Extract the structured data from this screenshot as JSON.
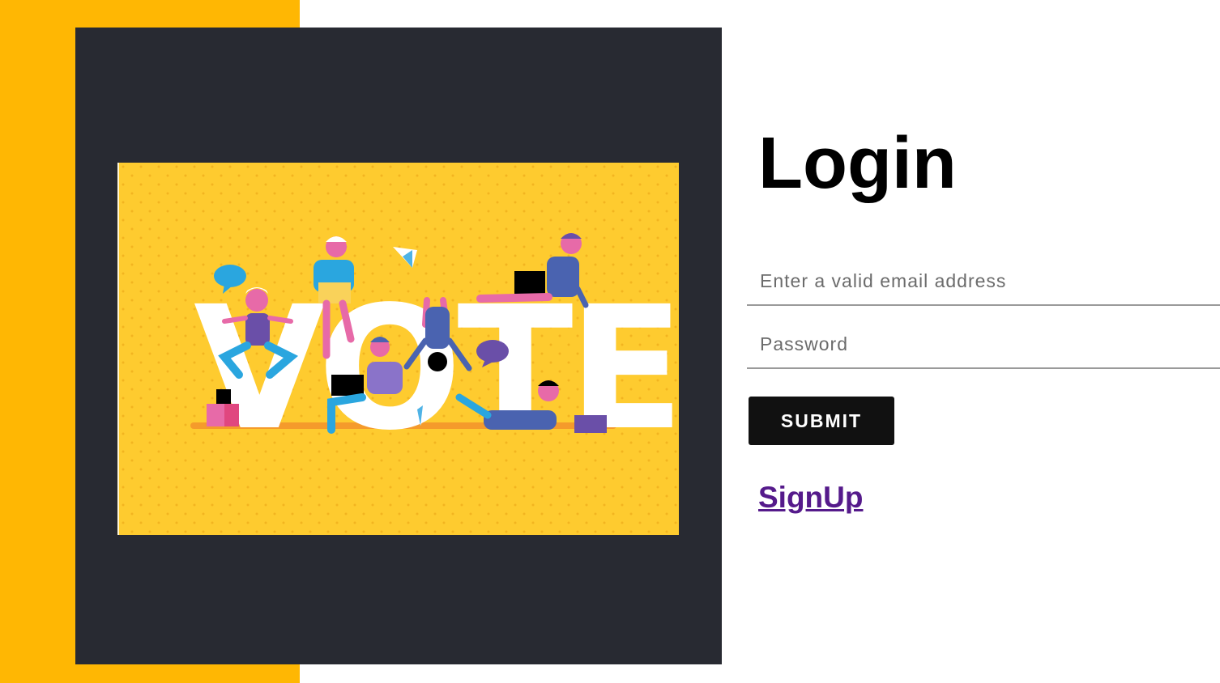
{
  "login": {
    "title": "Login",
    "email_placeholder": "Enter a valid email address",
    "password_placeholder": "Password",
    "submit_label": "SUBMIT",
    "signup_label": "SignUp"
  },
  "illustration": {
    "text": "VOTE",
    "background_color": "#fecb2f"
  },
  "colors": {
    "accent_yellow": "#ffb703",
    "dark_panel": "#282a32",
    "button": "#111111",
    "link": "#551a8b"
  }
}
